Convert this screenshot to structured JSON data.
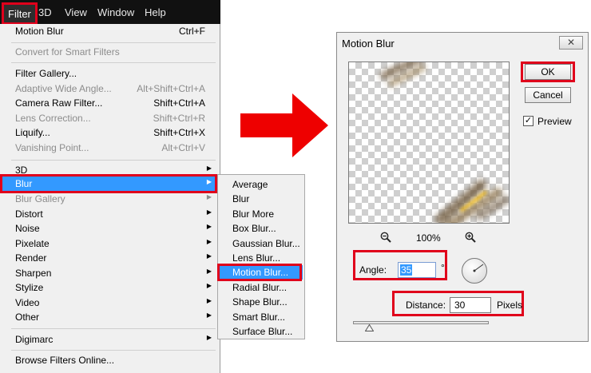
{
  "menubar": {
    "items": [
      "Filter",
      "3D",
      "View",
      "Window",
      "Help"
    ]
  },
  "filter_menu": {
    "last_filter": {
      "label": "Motion Blur",
      "shortcut": "Ctrl+F"
    },
    "convert": "Convert for Smart Filters",
    "gallery": {
      "label": "Filter Gallery..."
    },
    "adaptive": {
      "label": "Adaptive Wide Angle...",
      "shortcut": "Alt+Shift+Ctrl+A"
    },
    "camera_raw": {
      "label": "Camera Raw Filter...",
      "shortcut": "Shift+Ctrl+A"
    },
    "lens_correction": {
      "label": "Lens Correction...",
      "shortcut": "Shift+Ctrl+R"
    },
    "liquify": {
      "label": "Liquify...",
      "shortcut": "Shift+Ctrl+X"
    },
    "vanishing": {
      "label": "Vanishing Point...",
      "shortcut": "Alt+Ctrl+V"
    },
    "groups": [
      "3D",
      "Blur",
      "Blur Gallery",
      "Distort",
      "Noise",
      "Pixelate",
      "Render",
      "Sharpen",
      "Stylize",
      "Video",
      "Other"
    ],
    "digimarc": "Digimarc",
    "browse": "Browse Filters Online..."
  },
  "blur_submenu": {
    "items": [
      "Average",
      "Blur",
      "Blur More",
      "Box Blur...",
      "Gaussian Blur...",
      "Lens Blur...",
      "Motion Blur...",
      "Radial Blur...",
      "Shape Blur...",
      "Smart Blur...",
      "Surface Blur..."
    ]
  },
  "dialog": {
    "title": "Motion Blur",
    "close": "✕",
    "ok": "OK",
    "cancel": "Cancel",
    "preview_label": "Preview",
    "preview_checked": "✓",
    "zoom": "100%",
    "angle_label": "Angle:",
    "angle_value": "35",
    "degree": "°",
    "distance_label": "Distance:",
    "distance_value": "30",
    "distance_unit": "Pixels",
    "distance_fraction": 0.12
  },
  "colors": {
    "highlight": "#3399ff",
    "callout_red": "#e0001b",
    "menubar": "#111111"
  }
}
